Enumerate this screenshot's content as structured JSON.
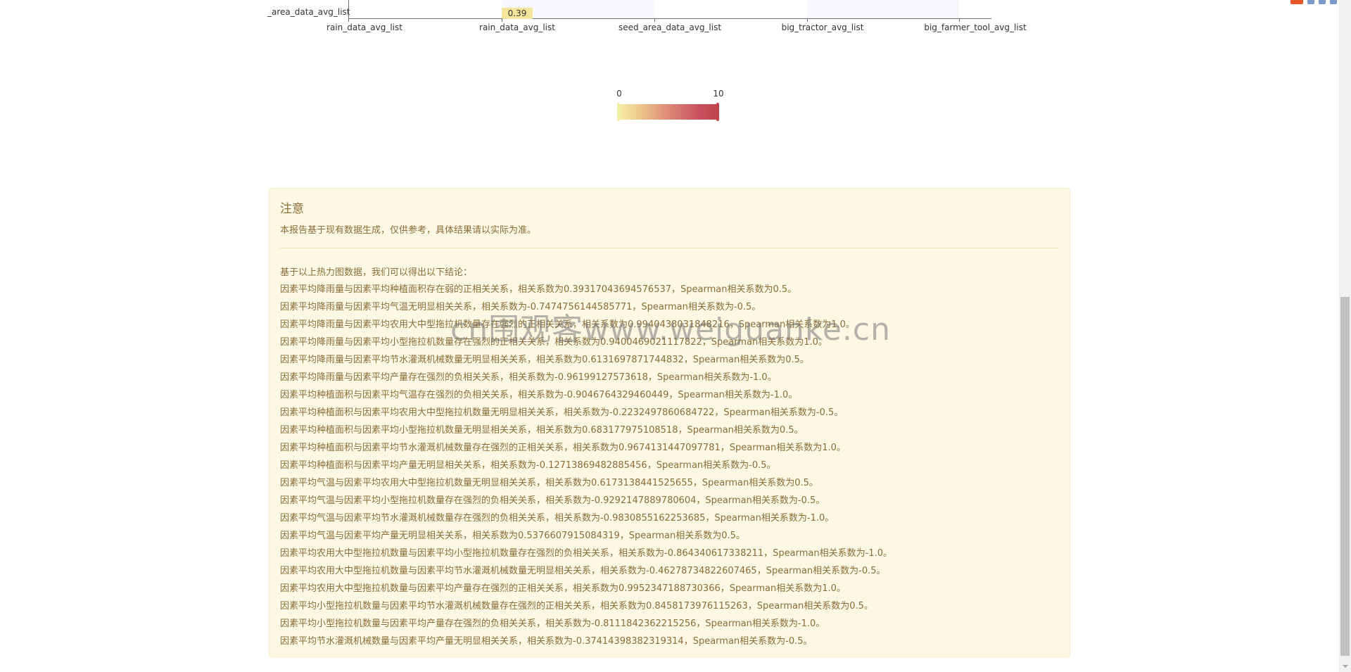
{
  "heatmap": {
    "y_label": "_area_data_avg_list",
    "cell_value": "0.39",
    "x_labels": [
      "rain_data_avg_list",
      "rain_data_avg_list",
      "seed_area_data_avg_list",
      "big_tractor_avg_list",
      "big_farmer_tool_avg_list"
    ]
  },
  "visual_map": {
    "min": "0",
    "max": "10",
    "colors": [
      "#f6efa6",
      "#bf444c"
    ]
  },
  "notice": {
    "title": "注意",
    "disclaimer": "本报告基于现有数据生成，仅供参考，具体结果请以实际为准。",
    "intro": "基于以上热力图数据，我们可以得出以下结论：",
    "conclusions": [
      "因素平均降雨量与因素平均种植面积存在弱的正相关关系，相关系数为0.39317043694576537，Spearman相关系数为0.5。",
      "因素平均降雨量与因素平均气温无明显相关关系，相关系数为-0.7474756144585771，Spearman相关系数为-0.5。",
      "因素平均降雨量与因素平均农用大中型拖拉机数量存在强烈的正相关关系，相关系数为0.9940438031848216，Spearman相关系数为1.0。",
      "因素平均降雨量与因素平均小型拖拉机数量存在强烈的正相关关系，相关系数为0.9400469021117822，Spearman相关系数为1.0。",
      "因素平均降雨量与因素平均节水灌溉机械数量无明显相关关系，相关系数为0.6131697871744832，Spearman相关系数为0.5。",
      "因素平均降雨量与因素平均产量存在强烈的负相关关系，相关系数为-0.96199127573618，Spearman相关系数为-1.0。",
      "因素平均种植面积与因素平均气温存在强烈的负相关关系，相关系数为-0.9046764329460449，Spearman相关系数为-1.0。",
      "因素平均种植面积与因素平均农用大中型拖拉机数量无明显相关关系，相关系数为-0.2232497860684722，Spearman相关系数为-0.5。",
      "因素平均种植面积与因素平均小型拖拉机数量无明显相关关系，相关系数为0.683177975108518，Spearman相关系数为0.5。",
      "因素平均种植面积与因素平均节水灌溉机械数量存在强烈的正相关关系，相关系数为0.9674131447097781，Spearman相关系数为1.0。",
      "因素平均种植面积与因素平均产量无明显相关关系，相关系数为-0.12713869482885456，Spearman相关系数为-0.5。",
      "因素平均气温与因素平均农用大中型拖拉机数量无明显相关关系，相关系数为0.6173138441525655，Spearman相关系数为0.5。",
      "因素平均气温与因素平均小型拖拉机数量存在强烈的负相关关系，相关系数为-0.9292147889780604，Spearman相关系数为-0.5。",
      "因素平均气温与因素平均节水灌溉机械数量存在强烈的负相关关系，相关系数为-0.9830855162253685，Spearman相关系数为-1.0。",
      "因素平均气温与因素平均产量无明显相关关系，相关系数为0.5376607915084319，Spearman相关系数为0.5。",
      "因素平均农用大中型拖拉机数量与因素平均小型拖拉机数量存在强烈的负相关关系，相关系数为-0.864340617338211，Spearman相关系数为-1.0。",
      "因素平均农用大中型拖拉机数量与因素平均节水灌溉机械数量无明显相关关系，相关系数为-0.46278734822607465，Spearman相关系数为-0.5。",
      "因素平均农用大中型拖拉机数量与因素平均产量存在强烈的正相关关系，相关系数为0.9952347188730366，Spearman相关系数为1.0。",
      "因素平均小型拖拉机数量与因素平均节水灌溉机械数量存在强烈的正相关关系，相关系数为0.8458173976115263，Spearman相关系数为0.5。",
      "因素平均小型拖拉机数量与因素平均产量存在强烈的负相关关系，相关系数为-0.8111842362215256，Spearman相关系数为-1.0。",
      "因素平均节水灌溉机械数量与因素平均产量无明显相关关系，相关系数为-0.37414398382319314，Spearman相关系数为-0.5。"
    ]
  },
  "watermark": "cn围观客www.weiguanke.cn"
}
